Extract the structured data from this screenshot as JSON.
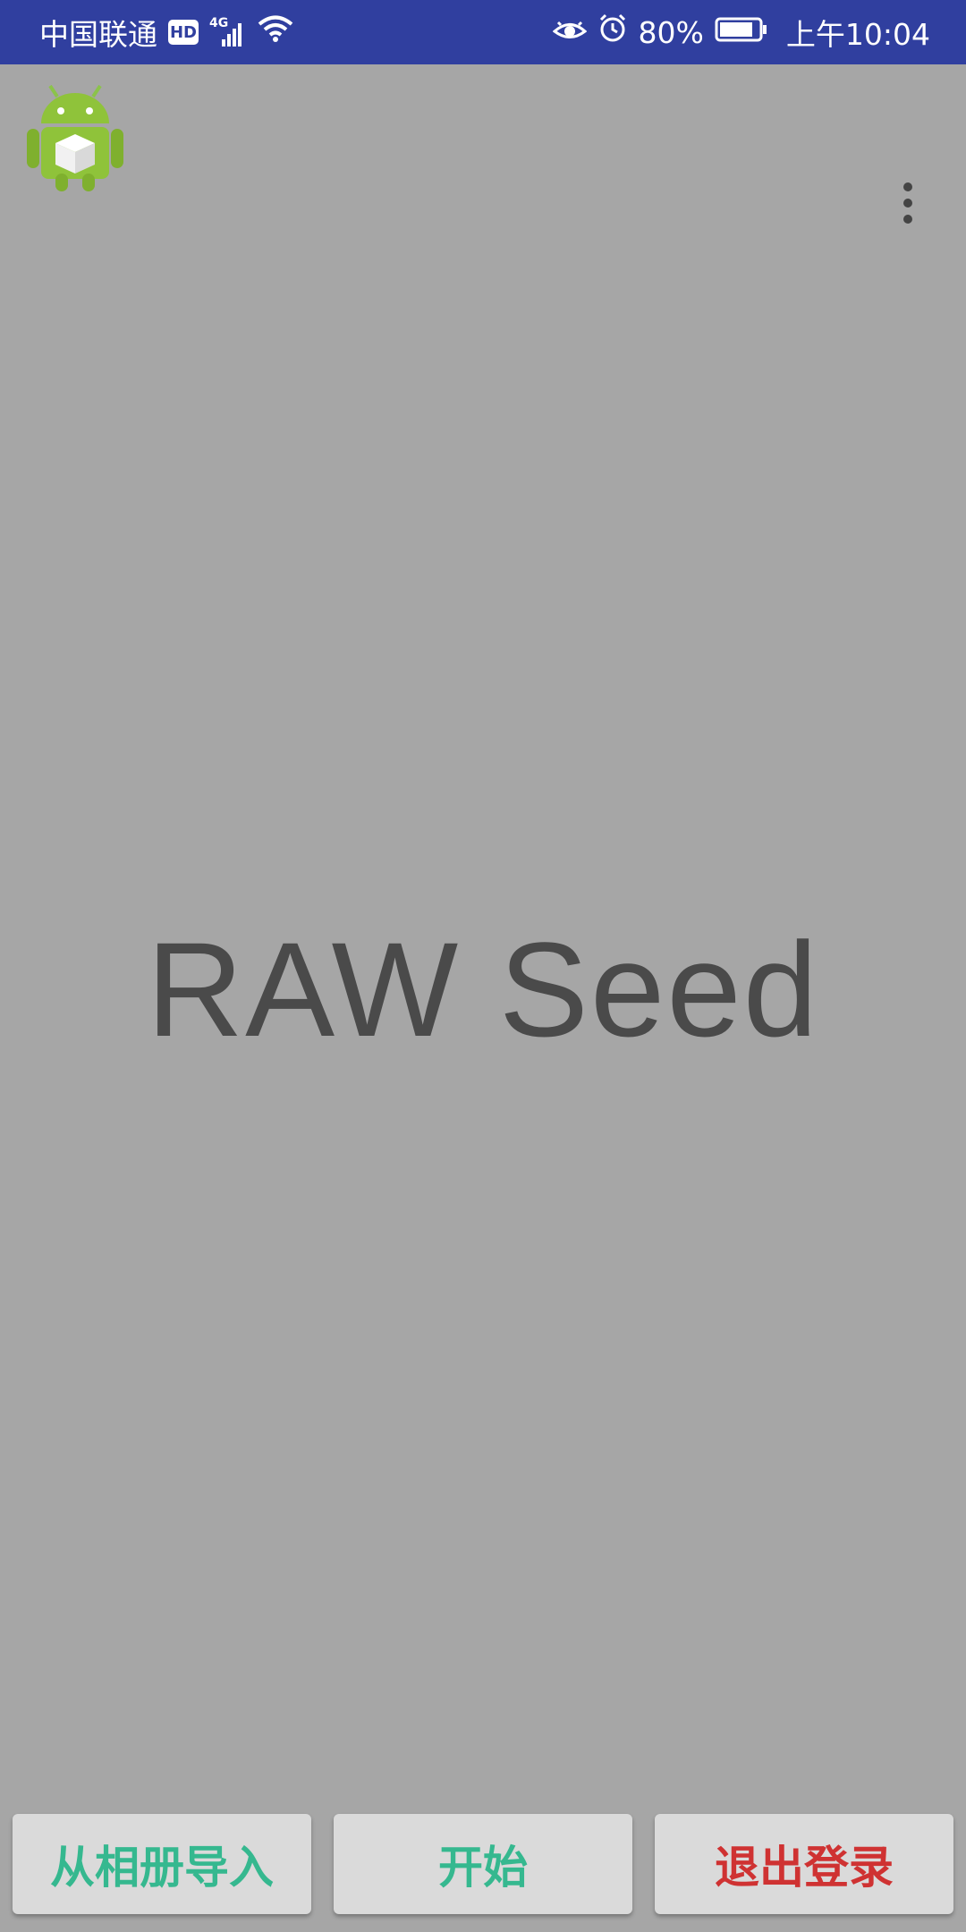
{
  "status_bar": {
    "carrier": "中国联通",
    "hd_badge": "HD",
    "network_type": "4G",
    "battery_percent": "80%",
    "time": "上午10:04",
    "icons": [
      "hd-icon",
      "signal-icon",
      "wifi-icon",
      "eye-icon",
      "alarm-icon",
      "battery-icon"
    ],
    "background_color": "#303f9f"
  },
  "toolbar": {
    "app_icon": "android-robot-cube-icon",
    "overflow_icon": "more-vert-icon"
  },
  "main": {
    "title": "RAW Seed",
    "background_color": "#a6a6a6"
  },
  "bottom_buttons": {
    "import_label": "从相册导入",
    "start_label": "开始",
    "logout_label": "退出登录",
    "accent_color": "#35b88f",
    "logout_color": "#cf3232"
  }
}
